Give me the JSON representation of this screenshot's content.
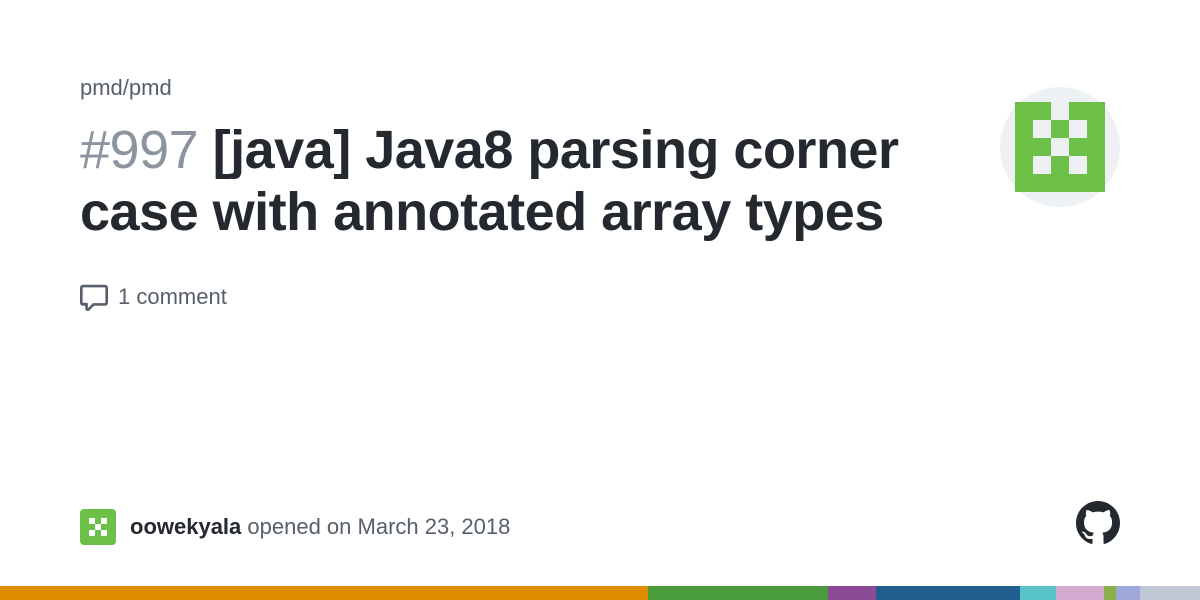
{
  "repo": {
    "path": "pmd/pmd"
  },
  "issue": {
    "number_prefix": "#997 ",
    "title": "[java] Java8 parsing corner case with annotated array types"
  },
  "comments": {
    "text": "1 comment"
  },
  "author": {
    "name": "oowekyala",
    "opened_text": " opened on March 23, 2018"
  },
  "bar_colors": [
    {
      "color": "#e08e00",
      "width": "54%"
    },
    {
      "color": "#4a9b3c",
      "width": "15%"
    },
    {
      "color": "#8d4b97",
      "width": "4%"
    },
    {
      "color": "#1f5e8e",
      "width": "12%"
    },
    {
      "color": "#58c4c8",
      "width": "3%"
    },
    {
      "color": "#d6a9d0",
      "width": "4%"
    },
    {
      "color": "#88b04b",
      "width": "1%"
    },
    {
      "color": "#9fa8da",
      "width": "2%"
    },
    {
      "color": "#c0c8d6",
      "width": "5%"
    }
  ]
}
